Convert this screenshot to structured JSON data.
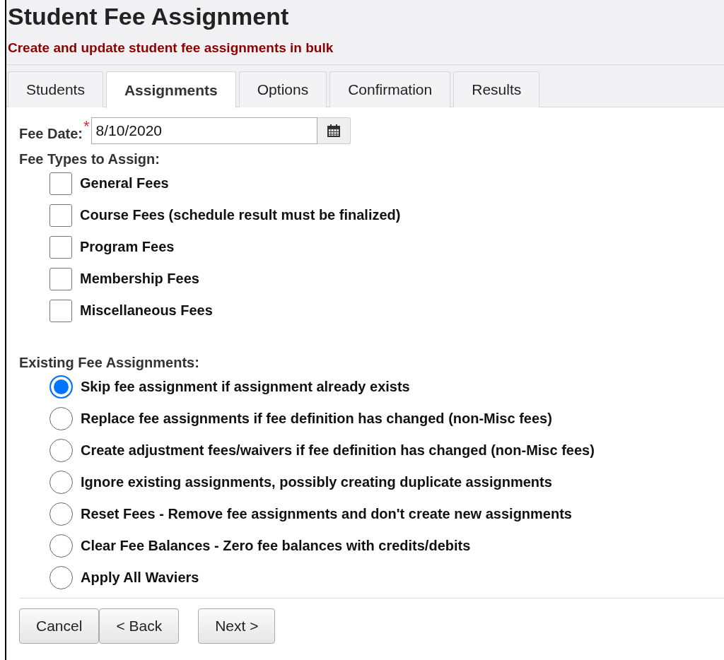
{
  "header": {
    "title": "Student Fee Assignment",
    "subtitle": "Create and update student fee assignments in bulk"
  },
  "tabs": [
    {
      "label": "Students",
      "selected": false
    },
    {
      "label": "Assignments",
      "selected": true
    },
    {
      "label": "Options",
      "selected": false
    },
    {
      "label": "Confirmation",
      "selected": false
    },
    {
      "label": "Results",
      "selected": false
    }
  ],
  "fee_date": {
    "label": "Fee Date:",
    "required_mark": "*",
    "value": "8/10/2020"
  },
  "fee_types": {
    "label": "Fee Types to Assign:",
    "items": [
      {
        "label": "General Fees",
        "checked": false
      },
      {
        "label": "Course Fees (schedule result must be finalized)",
        "checked": false
      },
      {
        "label": "Program Fees",
        "checked": false
      },
      {
        "label": "Membership Fees",
        "checked": false
      },
      {
        "label": "Miscellaneous Fees",
        "checked": false
      }
    ]
  },
  "existing": {
    "label": "Existing Fee Assignments:",
    "options": [
      {
        "label": "Skip fee assignment if assignment already exists",
        "selected": true
      },
      {
        "label": "Replace fee assignments if fee definition has changed (non-Misc fees)",
        "selected": false
      },
      {
        "label": "Create adjustment fees/waivers if fee definition has changed (non-Misc fees)",
        "selected": false
      },
      {
        "label": "Ignore existing assignments, possibly creating duplicate assignments",
        "selected": false
      },
      {
        "label": "Reset Fees - Remove fee assignments and don't create new assignments",
        "selected": false
      },
      {
        "label": "Clear Fee Balances - Zero fee balances with credits/debits",
        "selected": false
      },
      {
        "label": "Apply All Waviers",
        "selected": false
      }
    ]
  },
  "buttons": [
    "Cancel",
    "< Back",
    "Next >"
  ]
}
